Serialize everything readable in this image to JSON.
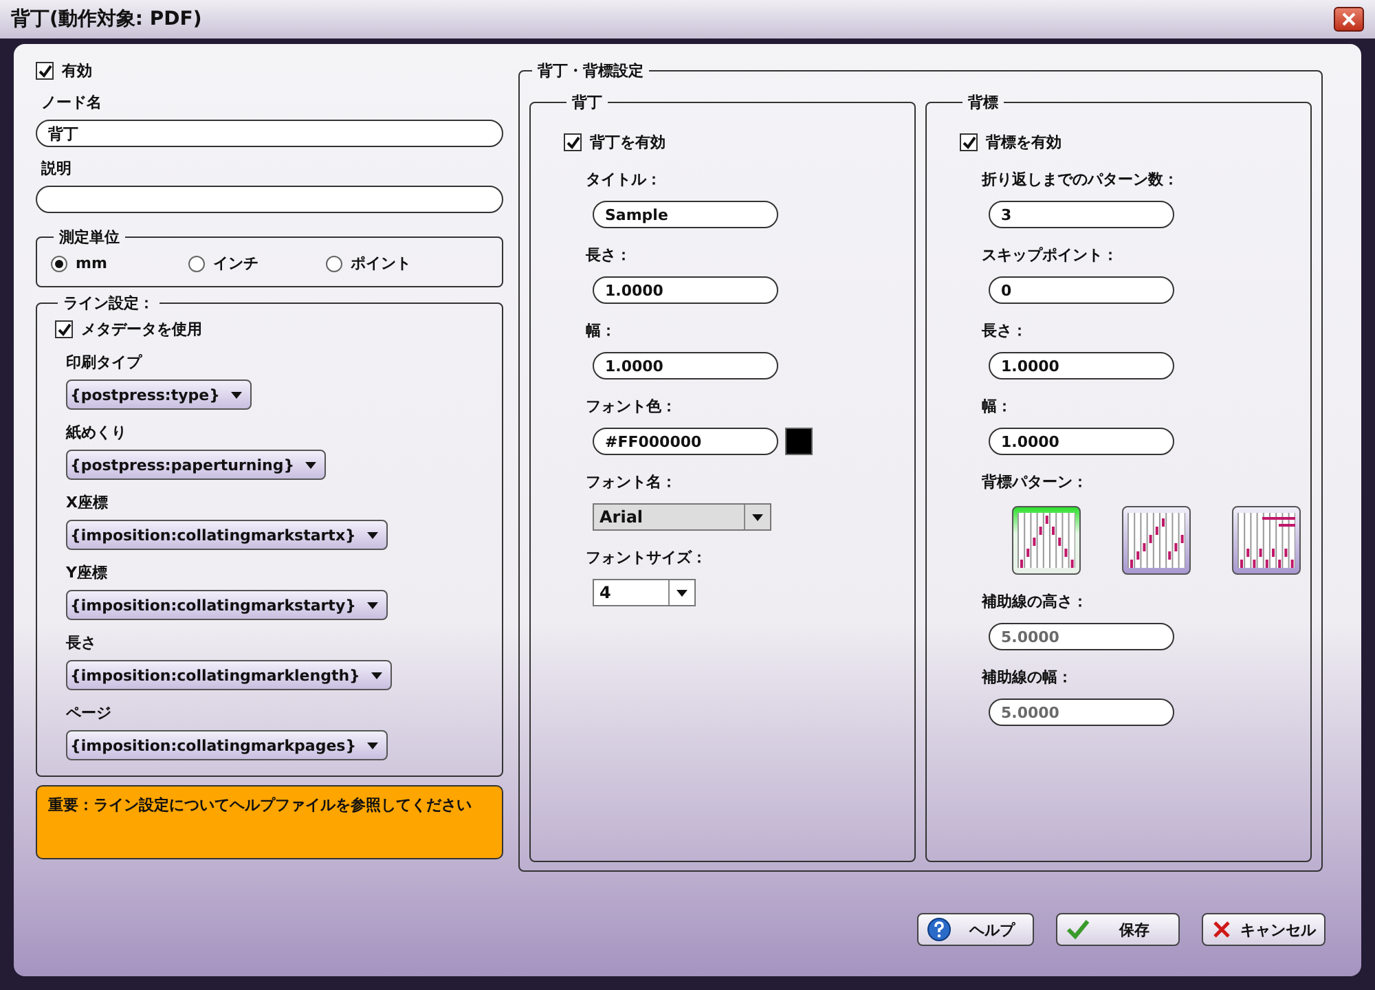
{
  "window": {
    "title": "背丁(動作対象: PDF)"
  },
  "enabled": {
    "label": "有効",
    "checked": true
  },
  "node_name": {
    "label": "ノード名",
    "value": "背丁"
  },
  "description": {
    "label": "説明"
  },
  "units": {
    "title": "測定単位",
    "options": [
      {
        "label": "mm",
        "selected": true
      },
      {
        "label": "インチ",
        "selected": false
      },
      {
        "label": "ポイント",
        "selected": false
      }
    ]
  },
  "line_settings": {
    "title": "ライン設定：",
    "use_metadata": {
      "label": "メタデータを使用",
      "checked": true
    },
    "fields": [
      {
        "label": "印刷タイプ",
        "value": "{postpress:type}"
      },
      {
        "label": "紙めくり",
        "value": "{postpress:paperturning}"
      },
      {
        "label": "X座標",
        "value": "{imposition:collatingmarkstartx}"
      },
      {
        "label": "Y座標",
        "value": "{imposition:collatingmarkstarty}"
      },
      {
        "label": "長さ",
        "value": "{imposition:collatingmarklength}"
      },
      {
        "label": "ページ",
        "value": "{imposition:collatingmarkpages}"
      }
    ]
  },
  "notice": "重要：ライン設定についてヘルプファイルを参照してください",
  "mark_settings": {
    "title": "背丁・背標設定",
    "panels": [
      {
        "title": "背丁",
        "enable": {
          "label": "背丁を有効",
          "checked": true
        },
        "fields": [
          {
            "kind": "text",
            "label": "タイトル：",
            "value": "Sample",
            "disabled": false
          },
          {
            "kind": "text",
            "label": "長さ：",
            "value": "1.0000",
            "disabled": false
          },
          {
            "kind": "text",
            "label": "幅：",
            "value": "1.0000",
            "disabled": false
          },
          {
            "kind": "color",
            "label": "フォント色：",
            "value": "#FF000000",
            "color": "#000000"
          },
          {
            "kind": "select",
            "label": "フォント名：",
            "value": "Arial"
          },
          {
            "kind": "combo",
            "label": "フォントサイズ：",
            "value": "4"
          }
        ]
      },
      {
        "title": "背標",
        "enable": {
          "label": "背標を有効",
          "checked": true
        },
        "fields": [
          {
            "kind": "text",
            "label": "折り返しまでのパターン数：",
            "value": "3",
            "disabled": false
          },
          {
            "kind": "text",
            "label": "スキップポイント：",
            "value": "0",
            "disabled": false
          },
          {
            "kind": "text",
            "label": "長さ：",
            "value": "1.0000",
            "disabled": false
          },
          {
            "kind": "text",
            "label": "幅：",
            "value": "1.0000",
            "disabled": false
          },
          {
            "kind": "patterns",
            "label": "背標パターン：",
            "options": [
              {
                "kind": "peak",
                "selected": true
              },
              {
                "kind": "rising",
                "selected": false
              },
              {
                "kind": "banded",
                "selected": false
              }
            ]
          },
          {
            "kind": "text",
            "label": "補助線の高さ：",
            "value": "5.0000",
            "disabled": true
          },
          {
            "kind": "text",
            "label": "補助線の幅：",
            "value": "5.0000",
            "disabled": true
          }
        ]
      }
    ]
  },
  "buttons": [
    {
      "kind": "help",
      "label": "ヘルプ"
    },
    {
      "kind": "save",
      "label": "保存"
    },
    {
      "kind": "cancel",
      "label": "キャンセル"
    }
  ]
}
